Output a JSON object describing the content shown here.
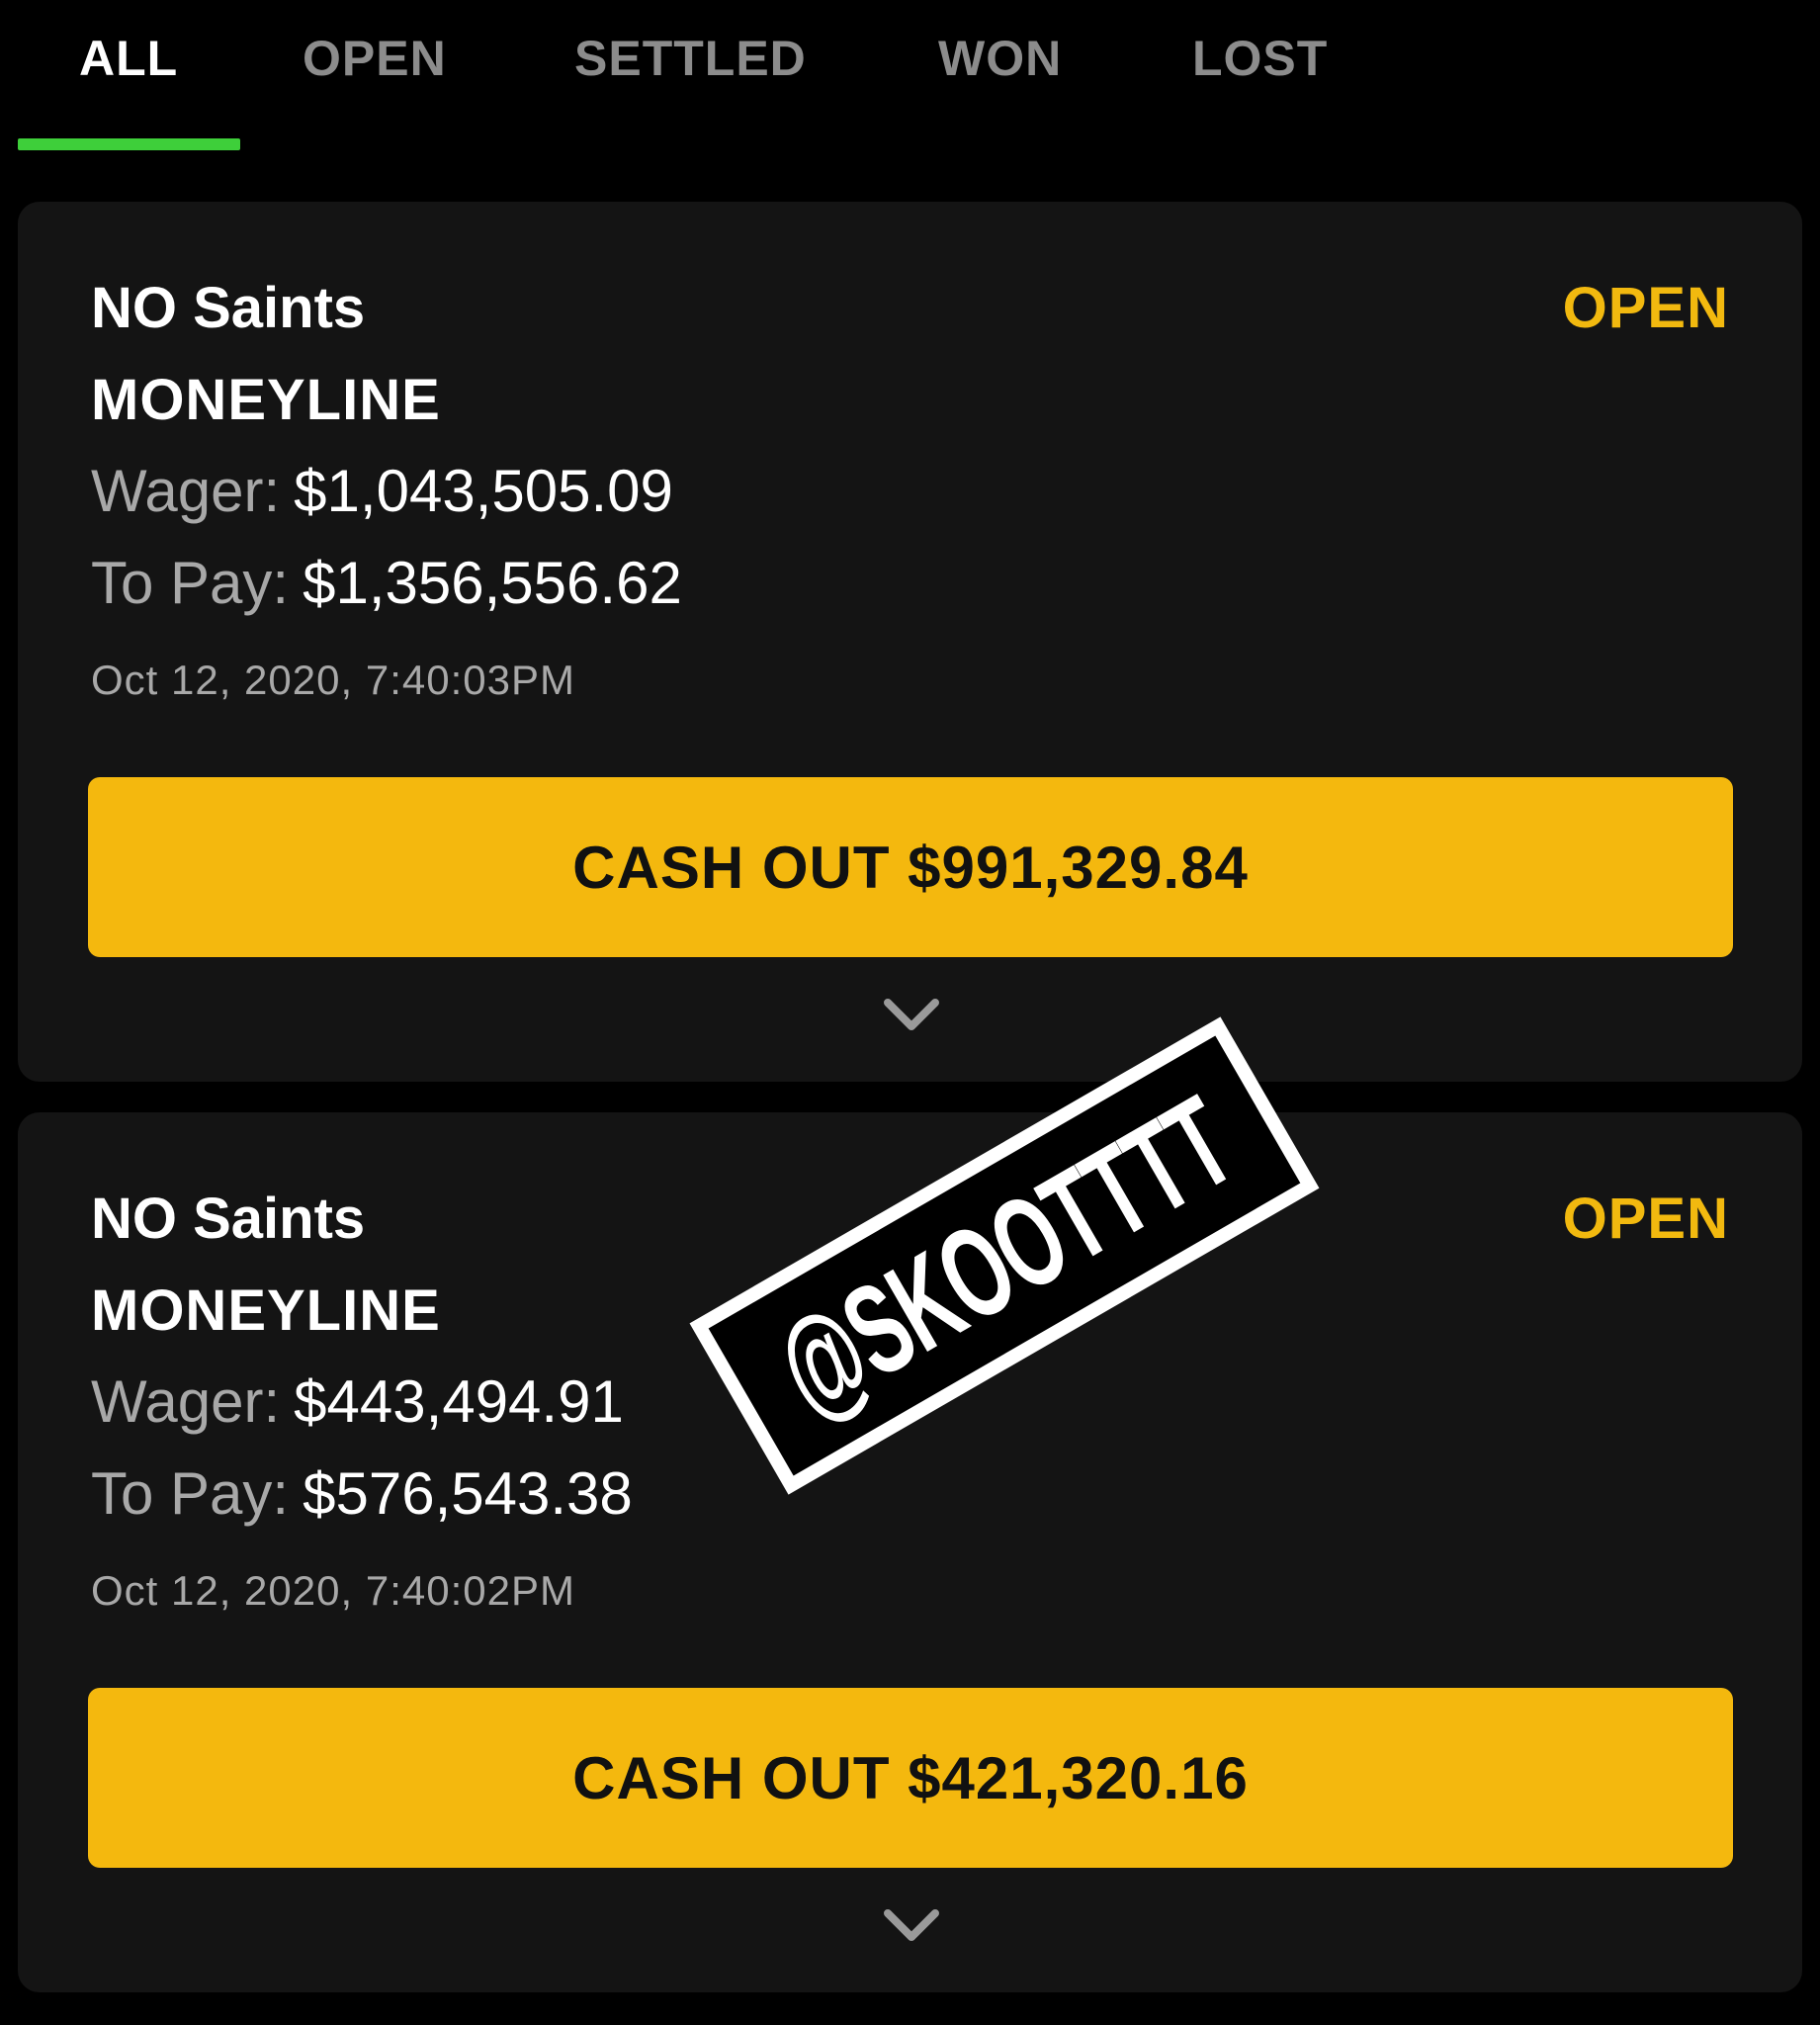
{
  "tabs": [
    {
      "label": "ALL",
      "active": true
    },
    {
      "label": "OPEN",
      "active": false
    },
    {
      "label": "SETTLED",
      "active": false
    },
    {
      "label": "WON",
      "active": false
    },
    {
      "label": "LOST",
      "active": false
    }
  ],
  "bets": [
    {
      "team": "NO Saints",
      "status": "OPEN",
      "bet_type": "MONEYLINE",
      "wager_label": "Wager:",
      "wager_value": "$1,043,505.09",
      "to_pay_label": "To Pay:",
      "to_pay_value": "$1,356,556.62",
      "timestamp": "Oct 12, 2020, 7:40:03PM",
      "cash_out_label": "CASH OUT $991,329.84"
    },
    {
      "team": "NO Saints",
      "status": "OPEN",
      "bet_type": "MONEYLINE",
      "wager_label": "Wager:",
      "wager_value": "$443,494.91",
      "to_pay_label": "To Pay:",
      "to_pay_value": "$576,543.38",
      "timestamp": "Oct 12, 2020, 7:40:02PM",
      "cash_out_label": "CASH OUT $421,320.16"
    }
  ],
  "watermark": "@SKOOTTTT",
  "colors": {
    "background": "#000000",
    "card": "#141414",
    "accent_green": "#3ecf3a",
    "accent_yellow": "#f4b80e",
    "status_open": "#f2b90f"
  },
  "icons": {
    "expand": "chevron-down-icon"
  }
}
